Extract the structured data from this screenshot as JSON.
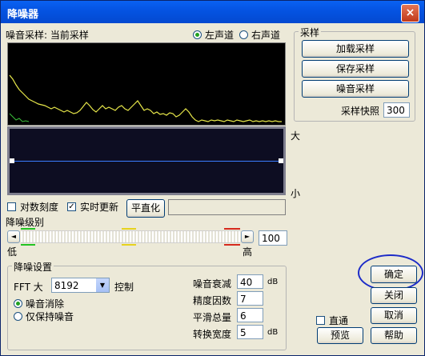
{
  "window": {
    "title": "降噪器",
    "close_glyph": "×"
  },
  "noise_sample": {
    "label": "噪音采样: 当前采样",
    "channel_left": "左声道",
    "channel_right": "右声道",
    "channel_selected": "left"
  },
  "sample_group": {
    "title": "采样",
    "load_button": "加载采样",
    "save_button": "保存采样",
    "capture_button": "噪音采样",
    "snapshot_label": "采样快照",
    "snapshot_value": "300"
  },
  "curve": {
    "label_high": "大",
    "label_low": "小"
  },
  "options": {
    "log_scale_label": "对数刻度",
    "log_scale_checked": false,
    "realtime_label": "实时更新",
    "realtime_checked": true,
    "flatten_button": "平直化"
  },
  "noise_level": {
    "label": "降噪级别",
    "value": "100",
    "low_label": "低",
    "high_label": "高",
    "slider_fraction": 1.0,
    "left_arrow": "◄",
    "right_arrow": "►"
  },
  "settings": {
    "title": "降噪设置",
    "fft_label": "FFT 大",
    "fft_value": "8192",
    "control_label": "控制",
    "mode_remove": "噪音消除",
    "mode_keep": "仅保持噪音",
    "mode_selected": "remove",
    "attenuation_label": "噪音衰减",
    "attenuation_value": "40",
    "attenuation_unit": "dB",
    "precision_label": "精度因数",
    "precision_value": "7",
    "smoothing_label": "平滑总量",
    "smoothing_value": "6",
    "transition_label": "转换宽度",
    "transition_value": "5",
    "transition_unit": "dB"
  },
  "actions": {
    "ok": "确定",
    "close": "关闭",
    "cancel": "取消",
    "help": "帮助",
    "preview": "预览",
    "bypass": "直通",
    "bypass_checked": false
  },
  "colors": {
    "accent_green": "#22c322",
    "accent_yellow": "#e6d21e",
    "accent_red": "#d62a1e",
    "highlight_ellipse": "#1c2bc8",
    "curve_line": "#3a7cff"
  }
}
